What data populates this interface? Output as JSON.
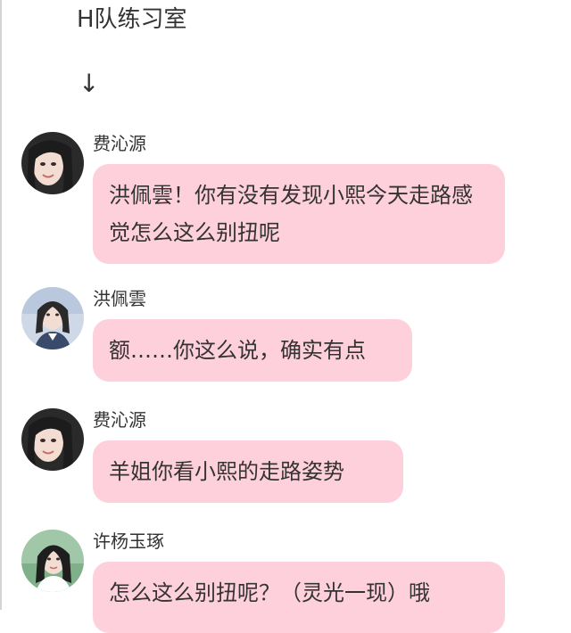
{
  "chat": {
    "room_title": "H队练习室",
    "arrow": "↓",
    "messages": [
      {
        "sender": "费沁源",
        "text": "洪佩雲！你有没有发现小熙今天走路感觉怎么这么别扭呢",
        "avatar": "portrait-avatar"
      },
      {
        "sender": "洪佩雲",
        "text": "额……你这么说，确实有点",
        "avatar": "portrait-avatar"
      },
      {
        "sender": "费沁源",
        "text": "羊姐你看小熙的走路姿势",
        "avatar": "portrait-avatar"
      },
      {
        "sender": "许杨玉琢",
        "text": "怎么这么别扭呢？（灵光一现）哦",
        "avatar": "portrait-avatar"
      }
    ]
  },
  "colors": {
    "bubble": "#fdd0dc",
    "text": "#333333",
    "background": "#ffffff"
  }
}
